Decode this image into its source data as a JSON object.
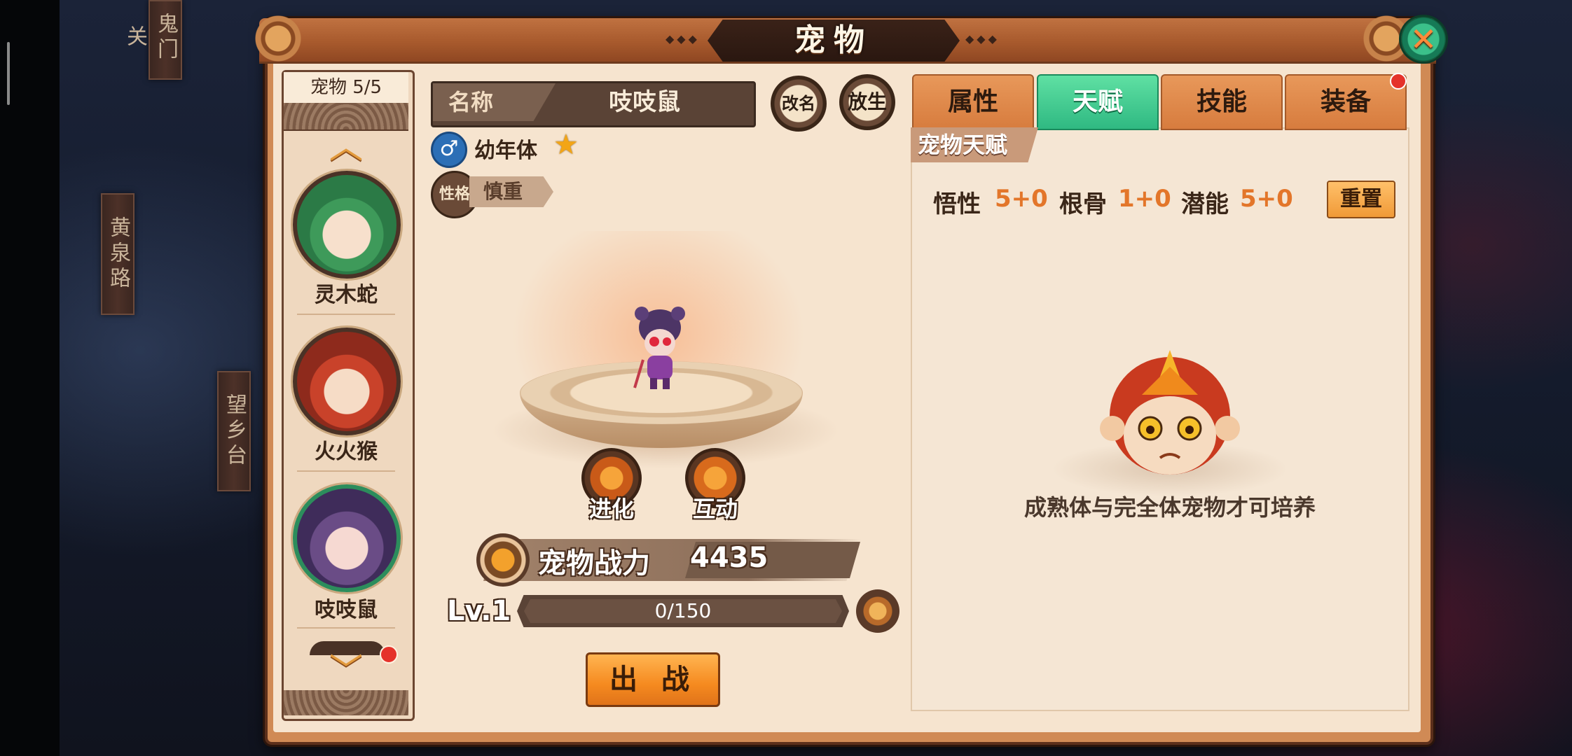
{
  "window": {
    "title": "宠物"
  },
  "background": {
    "signs": [
      "鬼门关",
      "黄泉路",
      "望乡台"
    ]
  },
  "list": {
    "header": "宠物 5/5",
    "pets": [
      {
        "name": "灵木蛇"
      },
      {
        "name": "火火猴"
      },
      {
        "name": "吱吱鼠"
      }
    ]
  },
  "pet": {
    "name_label": "名称",
    "name": "吱吱鼠",
    "stage": "幼年体",
    "nature_icon_text": "性格",
    "nature": "慎重",
    "release_label": "放生",
    "rename_label": "改名",
    "evolve_label": "进化",
    "interact_label": "互动",
    "power_label": "宠物战力",
    "power_value": "4435",
    "level": "Lv.1",
    "xp_text": "0/150",
    "xp_fraction": 0,
    "fight_label": "出 战"
  },
  "tabs": [
    {
      "label": "属性",
      "active": false
    },
    {
      "label": "天赋",
      "active": true
    },
    {
      "label": "技能",
      "active": false
    },
    {
      "label": "装备",
      "active": false
    }
  ],
  "talent": {
    "section_title": "宠物天赋",
    "stats": [
      {
        "label": "悟性",
        "value": "5+0"
      },
      {
        "label": "根骨",
        "value": "1+0"
      },
      {
        "label": "潜能",
        "value": "5+0"
      }
    ],
    "reset_label": "重置",
    "notice": "成熟体与完全体宠物才可培养"
  },
  "colors": {
    "accent_green": "#2fb982",
    "accent_orange": "#f58a1f",
    "stat_value": "#e3762a"
  }
}
